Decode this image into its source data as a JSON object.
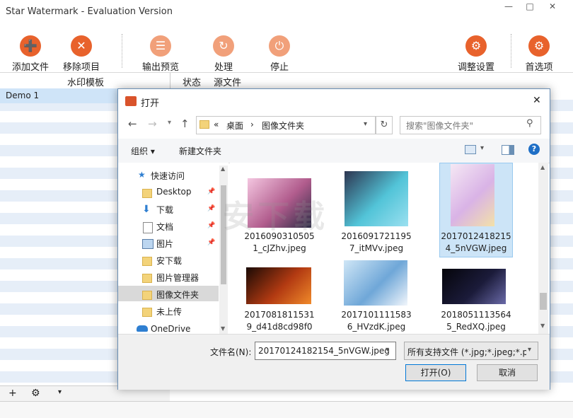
{
  "window": {
    "title": "Star Watermark - Evaluation Version",
    "controls": {
      "minimize": "—",
      "maximize": "□",
      "close": "✕"
    }
  },
  "toolbar": {
    "items": [
      {
        "label": "添加文件",
        "icon": "add-file-icon",
        "glyph": "➕"
      },
      {
        "label": "移除项目",
        "icon": "remove-icon",
        "glyph": "✕"
      },
      {
        "label": "输出预览",
        "icon": "preview-icon",
        "glyph": "☰"
      },
      {
        "label": "处理",
        "icon": "process-icon",
        "glyph": "↻"
      },
      {
        "label": "停止",
        "icon": "stop-icon",
        "glyph": "⏻"
      },
      {
        "label": "调整设置",
        "icon": "settings-icon",
        "glyph": "⚙"
      },
      {
        "label": "首选项",
        "icon": "preferences-icon",
        "glyph": "⚙"
      }
    ]
  },
  "columns": {
    "template": "水印模板",
    "status": "状态",
    "source": "源文件"
  },
  "templates": [
    "Demo 1"
  ],
  "bottom_bar": {
    "add": "+",
    "settings": "⚙",
    "dropdown": "▾"
  },
  "dialog": {
    "title": "打开",
    "close": "✕",
    "breadcrumb": {
      "prefix": "«",
      "items": [
        "桌面",
        "图像文件夹"
      ],
      "sep": "›"
    },
    "search_placeholder": "搜索\"图像文件夹\"",
    "organize": "组织 ▾",
    "new_folder": "新建文件夹",
    "nav": [
      {
        "label": "快速访问",
        "type": "quick"
      },
      {
        "label": "Desktop",
        "type": "folder",
        "pinned": true
      },
      {
        "label": "下载",
        "type": "download",
        "pinned": true
      },
      {
        "label": "文档",
        "type": "doc",
        "pinned": true
      },
      {
        "label": "图片",
        "type": "pic",
        "pinned": true
      },
      {
        "label": "安下载",
        "type": "folder",
        "pinned": false
      },
      {
        "label": "图片管理器",
        "type": "folder",
        "pinned": false
      },
      {
        "label": "图像文件夹",
        "type": "folder",
        "pinned": false,
        "selected": true
      },
      {
        "label": "未上传",
        "type": "folder",
        "pinned": false
      },
      {
        "label": "OneDrive",
        "type": "cloud",
        "pinned": false
      }
    ],
    "files": [
      {
        "line1": "2016090310505",
        "line2": "1_cJZhv.jpeg",
        "colors": [
          "#f4c6e0",
          "#b15c8d",
          "#2b2b45"
        ]
      },
      {
        "line1": "2016091721195",
        "line2": "7_itMVv.jpeg",
        "colors": [
          "#2d3550",
          "#52c4d8",
          "#9be0f0"
        ]
      },
      {
        "line1": "2017012418215",
        "line2": "4_5nVGW.jpeg",
        "colors": [
          "#f5e8f4",
          "#d9b3e6",
          "#f3e1a8"
        ],
        "selected": true
      },
      {
        "line1": "2017081811531",
        "line2": "9_d41d8cd98f0",
        "colors": [
          "#1a0a05",
          "#b23a12",
          "#f08a2a"
        ]
      },
      {
        "line1": "2017101111583",
        "line2": "6_HVzdK.jpeg",
        "colors": [
          "#cfe6f6",
          "#6fa7d8",
          "#f2f6fb"
        ]
      },
      {
        "line1": "2018051113564",
        "line2": "5_RedXQ.jpeg",
        "colors": [
          "#05050a",
          "#1b1b3a",
          "#6a6aa8"
        ]
      }
    ],
    "filename_label": "文件名(N):",
    "filename_value": "20170124182154_5nVGW.jpeg",
    "filetype_value": "所有支持文件 (*.jpg;*.jpeg;*.p",
    "open_button": "打开(O)",
    "cancel_button": "取消",
    "watermark_text": "安下载"
  },
  "colors": {
    "accent": "#e8622c",
    "selection": "#cce4f7",
    "row_alt": "#e6eef8"
  }
}
